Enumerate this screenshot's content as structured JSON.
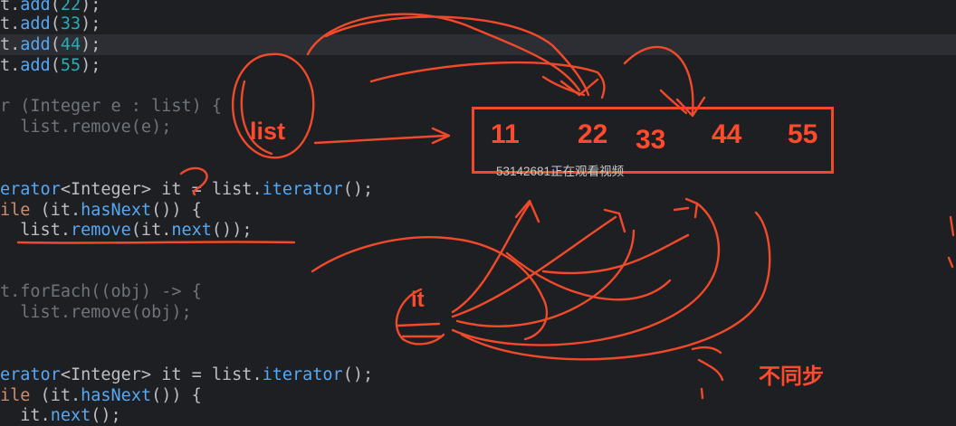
{
  "code_lines": [
    {
      "id": "l1",
      "parts": [
        [
          "ty",
          "t."
        ],
        [
          "fn",
          "add"
        ],
        [
          "ty",
          "("
        ],
        [
          "num",
          "22"
        ],
        [
          "ty",
          ");"
        ]
      ]
    },
    {
      "id": "l2",
      "parts": [
        [
          "ty",
          "t."
        ],
        [
          "fn",
          "add"
        ],
        [
          "ty",
          "("
        ],
        [
          "num",
          "33"
        ],
        [
          "ty",
          ");"
        ]
      ]
    },
    {
      "id": "l3",
      "parts": [
        [
          "ty",
          "t."
        ],
        [
          "fn",
          "add"
        ],
        [
          "ty",
          "("
        ],
        [
          "num",
          "44"
        ],
        [
          "ty",
          ");"
        ]
      ]
    },
    {
      "id": "l4",
      "parts": [
        [
          "ty",
          "t."
        ],
        [
          "fn",
          "add"
        ],
        [
          "ty",
          "("
        ],
        [
          "num",
          "55"
        ],
        [
          "ty",
          ");"
        ]
      ]
    },
    {
      "id": "l5",
      "parts": [
        [
          "dimc",
          "r (Integer e : list) {"
        ]
      ]
    },
    {
      "id": "l6",
      "parts": [
        [
          "dimc",
          "  list.remove(e);"
        ]
      ]
    },
    {
      "id": "l7",
      "parts": [
        [
          "fn",
          "erator"
        ],
        [
          "ty",
          "<Integer> it = list."
        ],
        [
          "fn",
          "iterator"
        ],
        [
          "ty",
          "();"
        ]
      ]
    },
    {
      "id": "l8",
      "parts": [
        [
          "kw",
          "ile"
        ],
        [
          "ty",
          " (it."
        ],
        [
          "fn",
          "hasNext"
        ],
        [
          "ty",
          "()) {"
        ]
      ]
    },
    {
      "id": "l9",
      "parts": [
        [
          "ty",
          "  list."
        ],
        [
          "fn",
          "remove"
        ],
        [
          "ty",
          "(it."
        ],
        [
          "fn",
          "next"
        ],
        [
          "ty",
          "());"
        ]
      ]
    },
    {
      "id": "l10",
      "parts": [
        [
          "dimc",
          "t.forEach((obj) -> {"
        ]
      ]
    },
    {
      "id": "l11",
      "parts": [
        [
          "dimc",
          "  list.remove(obj);"
        ]
      ]
    },
    {
      "id": "l12",
      "parts": [
        [
          "fn",
          "erator"
        ],
        [
          "ty",
          "<Integer> it = list."
        ],
        [
          "fn",
          "iterator"
        ],
        [
          "ty",
          "();"
        ]
      ]
    },
    {
      "id": "l13",
      "parts": [
        [
          "kw",
          "ile"
        ],
        [
          "ty",
          " (it."
        ],
        [
          "fn",
          "hasNext"
        ],
        [
          "ty",
          "()) {"
        ]
      ]
    },
    {
      "id": "l14",
      "parts": [
        [
          "ty",
          "  it."
        ],
        [
          "fn",
          "next"
        ],
        [
          "ty",
          "();"
        ]
      ]
    }
  ],
  "annotations": {
    "list_label": "list",
    "it_label": "it",
    "note": "不同步",
    "viewer": "53142681正在观看视频",
    "values": [
      "11",
      "22",
      "33",
      "44",
      "55"
    ]
  },
  "colors": {
    "ink": "#ff4a2d",
    "background": "#1e1f22",
    "number": "#2aacb8",
    "method": "#56a8f5",
    "keyword": "#cf8e6d"
  }
}
